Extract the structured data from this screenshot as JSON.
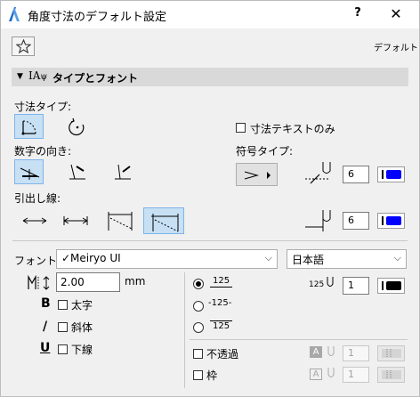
{
  "window": {
    "title": "角度寸法のデフォルト設定",
    "help_label": "?",
    "close_label": "✕",
    "default_label": "デフォルト"
  },
  "section": {
    "title": "タイプとフォント"
  },
  "dimension_type": {
    "label": "寸法タイプ:",
    "text_only_label": "寸法テキストのみ",
    "text_only_checked": false
  },
  "number_direction": {
    "label": "数字の向き:"
  },
  "symbol_type": {
    "label": "符号タイプ:",
    "size_value": "6",
    "pen_color": "#0000ff"
  },
  "leader_line": {
    "label": "引出し線:",
    "size_value": "6",
    "pen_color": "#0000ff"
  },
  "font": {
    "label": "フォント:",
    "font_value": "✓Meiryo UI",
    "language_value": "日本語",
    "size_value": "2.00",
    "size_unit": "mm",
    "bold_glyph": "B",
    "bold_label": "太字",
    "italic_glyph": "/",
    "italic_label": "斜体",
    "underline_glyph": "U",
    "underline_label": "下線"
  },
  "text_position": {
    "option1": "125",
    "option2": "-125-",
    "option3": "125",
    "text_pen_icon_label": "125",
    "text_pen_value": "1",
    "text_pen_color": "#000000"
  },
  "background": {
    "opaque_label": "不透過",
    "frame_label": "枠",
    "letter_a": "A",
    "opaque_pen_value": "1",
    "frame_pen_value": "1"
  }
}
